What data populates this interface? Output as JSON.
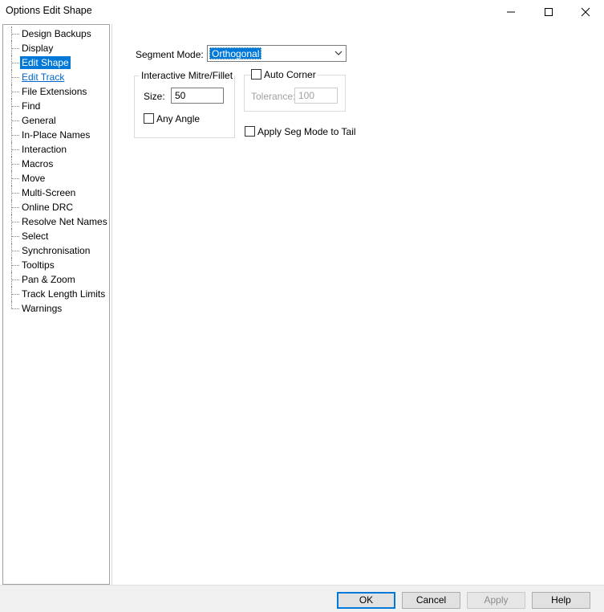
{
  "window": {
    "title": "Options  Edit Shape",
    "controls": [
      "minimize-icon",
      "maximize-icon",
      "close-icon"
    ]
  },
  "tree": {
    "items": [
      {
        "label": "Design Backups",
        "state": "normal"
      },
      {
        "label": "Display",
        "state": "normal"
      },
      {
        "label": "Edit Shape",
        "state": "selected"
      },
      {
        "label": "Edit Track",
        "state": "link"
      },
      {
        "label": "File Extensions",
        "state": "normal"
      },
      {
        "label": "Find",
        "state": "normal"
      },
      {
        "label": "General",
        "state": "normal"
      },
      {
        "label": "In-Place Names",
        "state": "normal"
      },
      {
        "label": "Interaction",
        "state": "normal"
      },
      {
        "label": "Macros",
        "state": "normal"
      },
      {
        "label": "Move",
        "state": "normal"
      },
      {
        "label": "Multi-Screen",
        "state": "normal"
      },
      {
        "label": "Online DRC",
        "state": "normal"
      },
      {
        "label": "Resolve Net Names",
        "state": "normal"
      },
      {
        "label": "Select",
        "state": "normal"
      },
      {
        "label": "Synchronisation",
        "state": "normal"
      },
      {
        "label": "Tooltips",
        "state": "normal"
      },
      {
        "label": "Pan & Zoom",
        "state": "normal"
      },
      {
        "label": "Track Length Limits",
        "state": "normal"
      },
      {
        "label": "Warnings",
        "state": "normal"
      }
    ]
  },
  "segment_mode": {
    "label": "Segment Mode:",
    "value": "Orthogonal"
  },
  "mitre": {
    "title": "Interactive Mitre/Fillet",
    "size_label": "Size:",
    "size_value": "50",
    "any_angle_label": "Any Angle",
    "any_angle_checked": false
  },
  "auto_corner": {
    "label": "Auto Corner",
    "checked": false,
    "tolerance_label": "Tolerance:",
    "tolerance_value": "100"
  },
  "apply_seg_mode": {
    "label": "Apply Seg Mode to Tail",
    "checked": false
  },
  "buttons": {
    "ok": "OK",
    "cancel": "Cancel",
    "apply": "Apply",
    "help": "Help"
  },
  "colors": {
    "selection": "#0078d7",
    "link": "#0066cc"
  }
}
